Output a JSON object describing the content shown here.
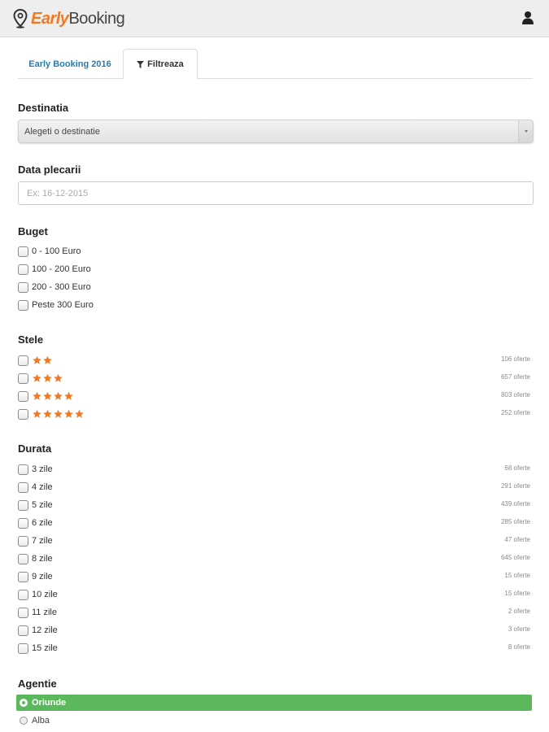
{
  "header": {
    "logo_early": "Early",
    "logo_booking": "Booking",
    "brand_color": "#f47920",
    "user_icon": "user-icon"
  },
  "tabs": [
    {
      "label": "Early Booking 2016",
      "active": false
    },
    {
      "label": "Filtreaza",
      "active": true,
      "icon": "filter-icon"
    }
  ],
  "destinatia": {
    "title": "Destinatia",
    "selected": "Alegeti o destinatie"
  },
  "data_plecarii": {
    "title": "Data plecarii",
    "placeholder": "Ex: 16-12-2015",
    "value": ""
  },
  "buget": {
    "title": "Buget",
    "options": [
      "0 - 100 Euro",
      "100 - 200 Euro",
      "200 - 300 Euro",
      "Peste 300 Euro"
    ]
  },
  "stele": {
    "title": "Stele",
    "star_color": "#f47920",
    "options": [
      {
        "stars": 2,
        "count": "106 oferte"
      },
      {
        "stars": 3,
        "count": "657 oferte"
      },
      {
        "stars": 4,
        "count": "803 oferte"
      },
      {
        "stars": 5,
        "count": "252 oferte"
      }
    ]
  },
  "durata": {
    "title": "Durata",
    "options": [
      {
        "label": "3 zile",
        "count": "68 oferte"
      },
      {
        "label": "4 zile",
        "count": "291 oferte"
      },
      {
        "label": "5 zile",
        "count": "439 oferte"
      },
      {
        "label": "6 zile",
        "count": "285 oferte"
      },
      {
        "label": "7 zile",
        "count": "47 oferte"
      },
      {
        "label": "8 zile",
        "count": "645 oferte"
      },
      {
        "label": "9 zile",
        "count": "15 oferte"
      },
      {
        "label": "10 zile",
        "count": "15 oferte"
      },
      {
        "label": "11 zile",
        "count": "2 oferte"
      },
      {
        "label": "12 zile",
        "count": "3 oferte"
      },
      {
        "label": "15 zile",
        "count": "8 oferte"
      }
    ]
  },
  "agentie": {
    "title": "Agentie",
    "selected_color": "#5cb85c",
    "options": [
      {
        "label": "Oriunde",
        "selected": true
      },
      {
        "label": "Alba",
        "selected": false
      }
    ]
  }
}
